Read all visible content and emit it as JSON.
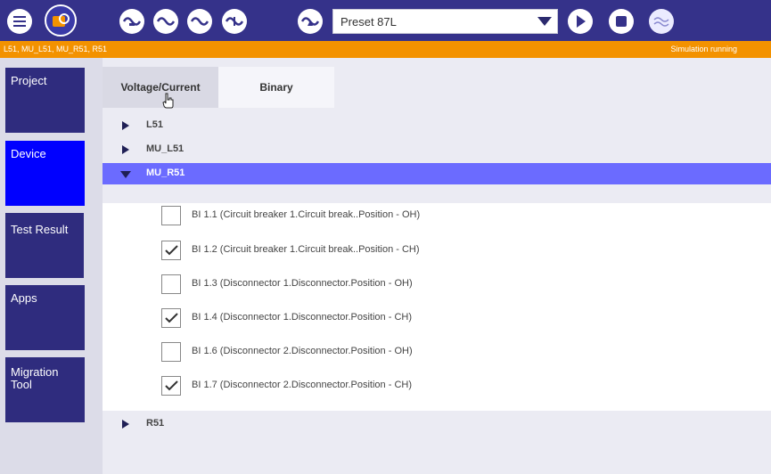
{
  "toolbar": {
    "preset": {
      "value": "Preset 87L"
    },
    "icons": [
      "menu-icon",
      "home-icon",
      "signal-a-icon",
      "signal-b-icon",
      "signal-c-icon",
      "signal-d-icon",
      "signal-e-icon",
      "play-icon",
      "stop-icon",
      "waveform-icon"
    ]
  },
  "status": {
    "devices": "L51, MU_L51, MU_R51, R51",
    "state": "Simulation running"
  },
  "sidebar": {
    "items": [
      {
        "label": "Project"
      },
      {
        "label": "Device"
      },
      {
        "label": "Test Result"
      },
      {
        "label": "Apps"
      },
      {
        "label": "Migration Tool"
      }
    ]
  },
  "tabs": [
    {
      "label": "Voltage/Current"
    },
    {
      "label": "Binary"
    }
  ],
  "tree": {
    "nodes": [
      {
        "label": "L51",
        "expanded": false
      },
      {
        "label": "MU_L51",
        "expanded": false
      },
      {
        "label": "MU_R51",
        "expanded": true
      },
      {
        "label": "R51",
        "expanded": false
      }
    ],
    "binary_inputs": [
      {
        "label": "BI 1.1 (Circuit breaker 1.Circuit break..Position - OH)",
        "checked": false
      },
      {
        "label": "BI 1.2 (Circuit breaker 1.Circuit break..Position - CH)",
        "checked": true
      },
      {
        "label": "BI 1.3 (Disconnector 1.Disconnector.Position - OH)",
        "checked": false
      },
      {
        "label": "BI 1.4 (Disconnector 1.Disconnector.Position - CH)",
        "checked": true
      },
      {
        "label": "BI 1.6 (Disconnector 2.Disconnector.Position - OH)",
        "checked": false
      },
      {
        "label": "BI 1.7 (Disconnector 2.Disconnector.Position - CH)",
        "checked": true
      }
    ]
  },
  "colors": {
    "toolbar": "#35328a",
    "status_strip": "#f39200",
    "nav_item": "#2f2c7e",
    "nav_active": "#0000ff",
    "row_selected": "#6b6bff"
  }
}
